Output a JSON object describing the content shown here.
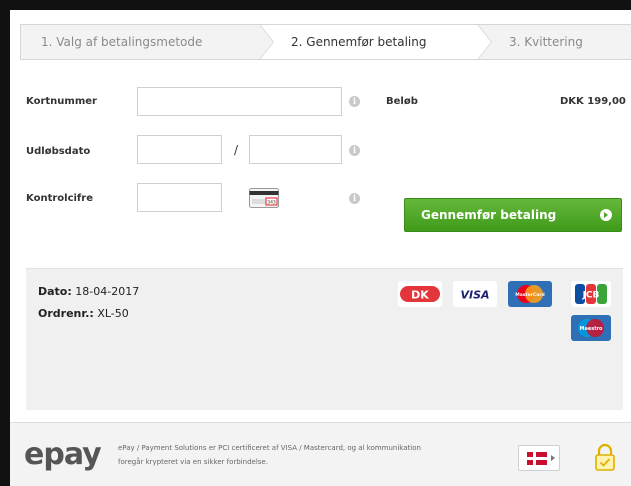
{
  "steps": [
    {
      "label": "1. Valg af betalingsmetode"
    },
    {
      "label": "2. Gennemfør betaling"
    },
    {
      "label": "3. Kvittering"
    }
  ],
  "form": {
    "card_number_label": "Kortnummer",
    "expiry_label": "Udløbsdato",
    "expiry_separator": "/",
    "cvc_label": "Kontrolcifre",
    "cvc_card_digits": "343",
    "card_number_value": "",
    "expiry_month_value": "",
    "expiry_year_value": "",
    "cvc_value": ""
  },
  "amount": {
    "label": "Beløb",
    "value": "DKK 199,00"
  },
  "pay_button": {
    "label": "Gennemfør betaling"
  },
  "order": {
    "date_label": "Dato:",
    "date_value": "18-04-2017",
    "order_label": "Ordrenr.:",
    "order_value": "XL-50"
  },
  "card_logos": [
    {
      "name": "dankort",
      "text": "DK",
      "color": "#e4363a"
    },
    {
      "name": "visa",
      "text": "VISA",
      "color": "#1a1f71"
    },
    {
      "name": "mastercard",
      "text": "MasterCard",
      "color": "#f79e1b"
    },
    {
      "name": "jcb",
      "text": "JCB",
      "color": "#0b4ea2"
    },
    {
      "name": "maestro",
      "text": "Maestro",
      "color": "#0099df"
    }
  ],
  "footer": {
    "brand": "epay",
    "line1": "ePay / Payment Solutions er PCI certificeret af VISA / Mastercard, og al kommunikation",
    "line2": "foregår krypteret via en sikker forbindelse."
  },
  "colors": {
    "pay_button": "#4aa526",
    "lock": "#e0b000"
  }
}
